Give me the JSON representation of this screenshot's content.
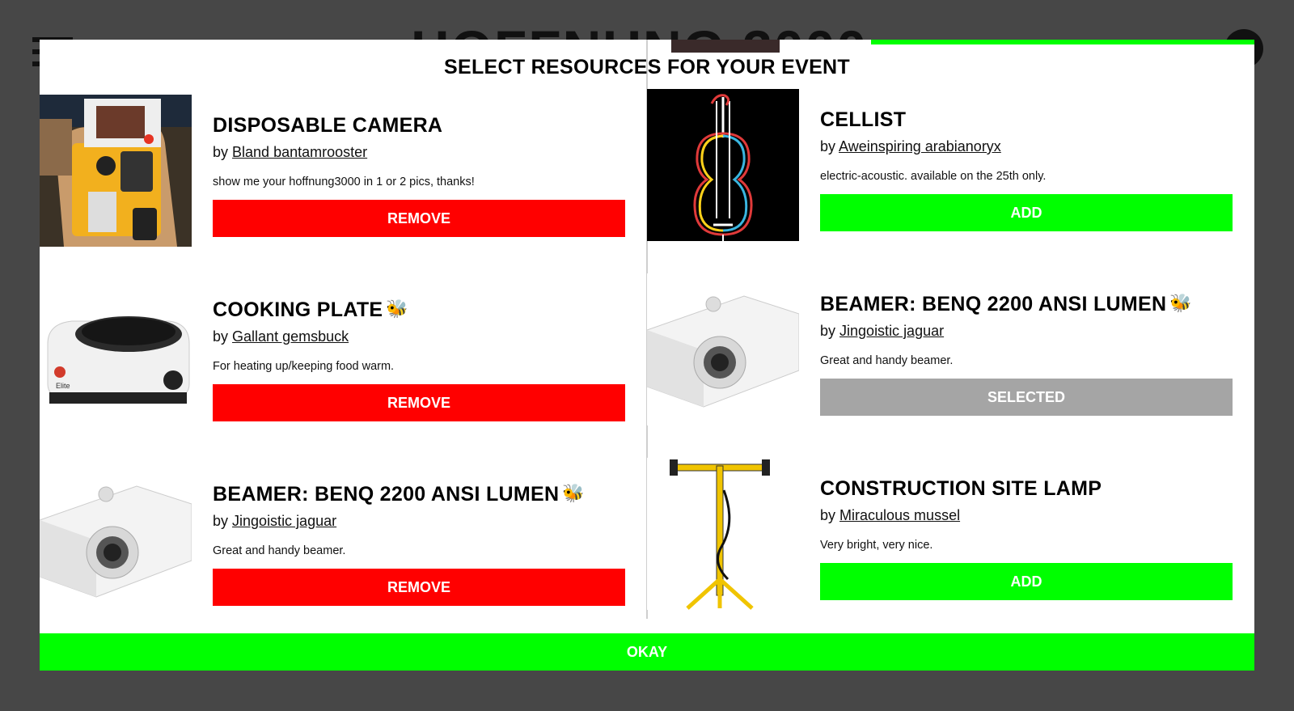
{
  "colors": {
    "backdrop": "#474747",
    "remove": "#ff0000",
    "add": "#00ff00",
    "selected": "#a5a5a5",
    "okay": "#00ff00"
  },
  "background": {
    "logo_text": "HOFFNUNG 3000",
    "menu_icon": "hamburger-icon",
    "user_icon": "user-circle-icon"
  },
  "modal": {
    "title": "SELECT RESOURCES FOR YOUR EVENT",
    "okay_label": "OKAY",
    "left_column": [
      {
        "name": "DISPOSABLE CAMERA",
        "bee": false,
        "by_prefix": "by",
        "owner": "Bland bantamrooster",
        "description": "show me your hoffnung3000 in 1 or 2 pics, thanks!",
        "button": "REMOVE",
        "image": "disposable-camera-image"
      },
      {
        "name": "COOKING PLATE",
        "bee": true,
        "bee_icon": "🐝",
        "by_prefix": "by",
        "owner": "Gallant gemsbuck",
        "description": "For heating up/keeping food warm.",
        "button": "REMOVE",
        "image": "cooking-plate-image"
      },
      {
        "name": "BEAMER: BENQ 2200 ANSI LUMEN",
        "bee": true,
        "bee_icon": "🐝",
        "by_prefix": "by",
        "owner": "Jingoistic jaguar",
        "description": "Great and handy beamer.",
        "button": "REMOVE",
        "image": "projector-image"
      }
    ],
    "right_column": [
      {
        "name": "CELLIST",
        "bee": false,
        "by_prefix": "by",
        "owner": "Aweinspiring arabianoryx",
        "description": "electric-acoustic. available on the 25th only.",
        "button": "ADD",
        "state": "add",
        "image": "cello-image"
      },
      {
        "name": "BEAMER: BENQ 2200 ANSI LUMEN",
        "bee": true,
        "bee_icon": "🐝",
        "by_prefix": "by",
        "owner": "Jingoistic jaguar",
        "description": "Great and handy beamer.",
        "button": "SELECTED",
        "state": "selected",
        "image": "projector-image"
      },
      {
        "name": "CONSTRUCTION SITE LAMP",
        "bee": false,
        "by_prefix": "by",
        "owner": "Miraculous mussel",
        "description": "Very bright, very nice.",
        "button": "ADD",
        "state": "add",
        "image": "construction-lamp-image"
      }
    ]
  }
}
